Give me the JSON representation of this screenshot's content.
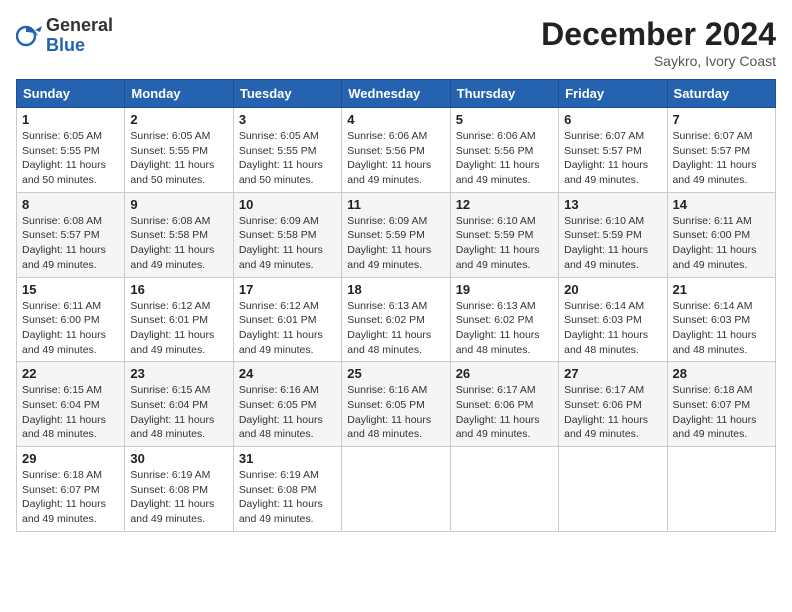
{
  "logo": {
    "general": "General",
    "blue": "Blue"
  },
  "title": "December 2024",
  "location": "Saykro, Ivory Coast",
  "days_of_week": [
    "Sunday",
    "Monday",
    "Tuesday",
    "Wednesday",
    "Thursday",
    "Friday",
    "Saturday"
  ],
  "weeks": [
    [
      {
        "day": "1",
        "sunrise": "6:05 AM",
        "sunset": "5:55 PM",
        "daylight": "11 hours and 50 minutes."
      },
      {
        "day": "2",
        "sunrise": "6:05 AM",
        "sunset": "5:55 PM",
        "daylight": "11 hours and 50 minutes."
      },
      {
        "day": "3",
        "sunrise": "6:05 AM",
        "sunset": "5:55 PM",
        "daylight": "11 hours and 50 minutes."
      },
      {
        "day": "4",
        "sunrise": "6:06 AM",
        "sunset": "5:56 PM",
        "daylight": "11 hours and 49 minutes."
      },
      {
        "day": "5",
        "sunrise": "6:06 AM",
        "sunset": "5:56 PM",
        "daylight": "11 hours and 49 minutes."
      },
      {
        "day": "6",
        "sunrise": "6:07 AM",
        "sunset": "5:57 PM",
        "daylight": "11 hours and 49 minutes."
      },
      {
        "day": "7",
        "sunrise": "6:07 AM",
        "sunset": "5:57 PM",
        "daylight": "11 hours and 49 minutes."
      }
    ],
    [
      {
        "day": "8",
        "sunrise": "6:08 AM",
        "sunset": "5:57 PM",
        "daylight": "11 hours and 49 minutes."
      },
      {
        "day": "9",
        "sunrise": "6:08 AM",
        "sunset": "5:58 PM",
        "daylight": "11 hours and 49 minutes."
      },
      {
        "day": "10",
        "sunrise": "6:09 AM",
        "sunset": "5:58 PM",
        "daylight": "11 hours and 49 minutes."
      },
      {
        "day": "11",
        "sunrise": "6:09 AM",
        "sunset": "5:59 PM",
        "daylight": "11 hours and 49 minutes."
      },
      {
        "day": "12",
        "sunrise": "6:10 AM",
        "sunset": "5:59 PM",
        "daylight": "11 hours and 49 minutes."
      },
      {
        "day": "13",
        "sunrise": "6:10 AM",
        "sunset": "5:59 PM",
        "daylight": "11 hours and 49 minutes."
      },
      {
        "day": "14",
        "sunrise": "6:11 AM",
        "sunset": "6:00 PM",
        "daylight": "11 hours and 49 minutes."
      }
    ],
    [
      {
        "day": "15",
        "sunrise": "6:11 AM",
        "sunset": "6:00 PM",
        "daylight": "11 hours and 49 minutes."
      },
      {
        "day": "16",
        "sunrise": "6:12 AM",
        "sunset": "6:01 PM",
        "daylight": "11 hours and 49 minutes."
      },
      {
        "day": "17",
        "sunrise": "6:12 AM",
        "sunset": "6:01 PM",
        "daylight": "11 hours and 49 minutes."
      },
      {
        "day": "18",
        "sunrise": "6:13 AM",
        "sunset": "6:02 PM",
        "daylight": "11 hours and 48 minutes."
      },
      {
        "day": "19",
        "sunrise": "6:13 AM",
        "sunset": "6:02 PM",
        "daylight": "11 hours and 48 minutes."
      },
      {
        "day": "20",
        "sunrise": "6:14 AM",
        "sunset": "6:03 PM",
        "daylight": "11 hours and 48 minutes."
      },
      {
        "day": "21",
        "sunrise": "6:14 AM",
        "sunset": "6:03 PM",
        "daylight": "11 hours and 48 minutes."
      }
    ],
    [
      {
        "day": "22",
        "sunrise": "6:15 AM",
        "sunset": "6:04 PM",
        "daylight": "11 hours and 48 minutes."
      },
      {
        "day": "23",
        "sunrise": "6:15 AM",
        "sunset": "6:04 PM",
        "daylight": "11 hours and 48 minutes."
      },
      {
        "day": "24",
        "sunrise": "6:16 AM",
        "sunset": "6:05 PM",
        "daylight": "11 hours and 48 minutes."
      },
      {
        "day": "25",
        "sunrise": "6:16 AM",
        "sunset": "6:05 PM",
        "daylight": "11 hours and 48 minutes."
      },
      {
        "day": "26",
        "sunrise": "6:17 AM",
        "sunset": "6:06 PM",
        "daylight": "11 hours and 49 minutes."
      },
      {
        "day": "27",
        "sunrise": "6:17 AM",
        "sunset": "6:06 PM",
        "daylight": "11 hours and 49 minutes."
      },
      {
        "day": "28",
        "sunrise": "6:18 AM",
        "sunset": "6:07 PM",
        "daylight": "11 hours and 49 minutes."
      }
    ],
    [
      {
        "day": "29",
        "sunrise": "6:18 AM",
        "sunset": "6:07 PM",
        "daylight": "11 hours and 49 minutes."
      },
      {
        "day": "30",
        "sunrise": "6:19 AM",
        "sunset": "6:08 PM",
        "daylight": "11 hours and 49 minutes."
      },
      {
        "day": "31",
        "sunrise": "6:19 AM",
        "sunset": "6:08 PM",
        "daylight": "11 hours and 49 minutes."
      },
      null,
      null,
      null,
      null
    ]
  ]
}
